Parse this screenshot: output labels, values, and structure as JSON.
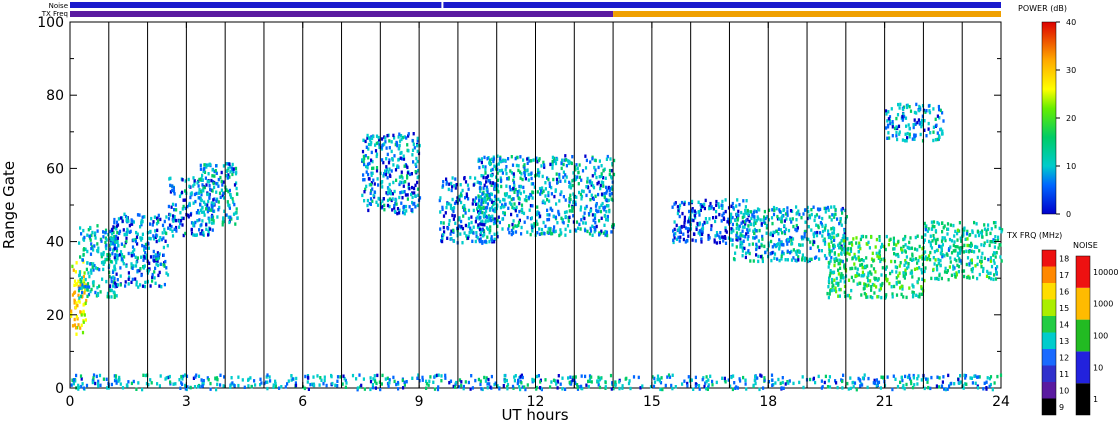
{
  "chart_data": {
    "type": "heatmap",
    "xlabel": "UT hours",
    "ylabel": "Range Gate",
    "xlim": [
      0,
      24
    ],
    "ylim": [
      0,
      100
    ],
    "x_ticks": [
      "0",
      "3",
      "6",
      "9",
      "12",
      "15",
      "18",
      "21",
      "24"
    ],
    "y_ticks": [
      "0",
      "20",
      "40",
      "60",
      "80",
      "100"
    ],
    "scan_markers_ut": [
      1,
      2,
      3,
      4,
      5,
      6,
      7,
      8,
      9,
      10,
      11,
      12,
      13,
      14,
      15,
      16,
      17,
      18,
      19,
      20,
      21,
      22,
      23
    ],
    "strips": {
      "noise_label": "Noise",
      "txfreq_label": "TX Freq",
      "noise_color": "#1a1acc",
      "txfreq_color_before": "#5a1aa0",
      "txfreq_color_after": "#f0a000",
      "txfreq_change_ut": 14.0,
      "gap_ut": 9.6
    },
    "power_scale": {
      "label": "POWER (dB)",
      "ticks": [
        "0",
        "10",
        "20",
        "30",
        "40"
      ],
      "range": [
        0,
        40
      ]
    },
    "txfreq_scale": {
      "label": "TX FRQ (MHz)",
      "ticks": [
        "9",
        "10",
        "11",
        "12",
        "13",
        "14",
        "15",
        "16",
        "17",
        "18"
      ]
    },
    "noise_scale": {
      "label": "NOISE",
      "ticks": [
        "1",
        "10",
        "100",
        "1000",
        "10000"
      ]
    },
    "echo_regions": [
      {
        "ut": [
          0.0,
          0.4
        ],
        "gate": [
          15,
          35
        ],
        "power_db": 30
      },
      {
        "ut": [
          0.2,
          1.2
        ],
        "gate": [
          25,
          45
        ],
        "power_db": 14
      },
      {
        "ut": [
          1.0,
          2.5
        ],
        "gate": [
          28,
          48
        ],
        "power_db": 10
      },
      {
        "ut": [
          2.5,
          3.7
        ],
        "gate": [
          42,
          58
        ],
        "power_db": 10
      },
      {
        "ut": [
          3.3,
          4.3
        ],
        "gate": [
          45,
          62
        ],
        "power_db": 12
      },
      {
        "ut": [
          7.5,
          9.0
        ],
        "gate": [
          48,
          70
        ],
        "power_db": 10
      },
      {
        "ut": [
          9.5,
          11.0
        ],
        "gate": [
          40,
          58
        ],
        "power_db": 10
      },
      {
        "ut": [
          10.5,
          14.0
        ],
        "gate": [
          42,
          64
        ],
        "power_db": 12
      },
      {
        "ut": [
          15.5,
          17.5
        ],
        "gate": [
          40,
          52
        ],
        "power_db": 8
      },
      {
        "ut": [
          17.0,
          20.0
        ],
        "gate": [
          35,
          50
        ],
        "power_db": 12
      },
      {
        "ut": [
          19.5,
          22.0
        ],
        "gate": [
          25,
          42
        ],
        "power_db": 18
      },
      {
        "ut": [
          22.0,
          24.0
        ],
        "gate": [
          30,
          46
        ],
        "power_db": 16
      },
      {
        "ut": [
          21.0,
          22.5
        ],
        "gate": [
          68,
          78
        ],
        "power_db": 10
      },
      {
        "ut": [
          0.0,
          24.0
        ],
        "gate": [
          0,
          4
        ],
        "power_db": 12
      }
    ]
  }
}
